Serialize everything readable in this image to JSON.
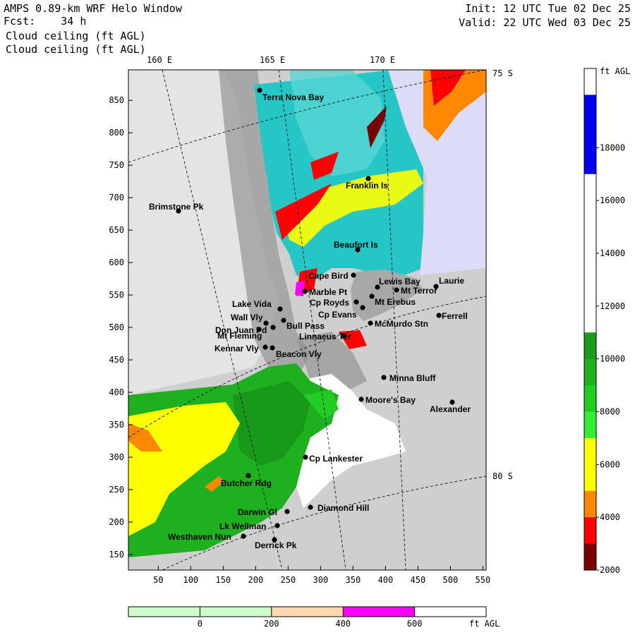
{
  "header": {
    "model": "AMPS 0.89-km WRF Helo Window",
    "fcst_label": "Fcst:",
    "fcst_value": "34 h",
    "field_1": "Cloud ceiling (ft AGL)",
    "field_2": "Cloud ceiling (ft AGL)",
    "init": "Init: 12 UTC Tue 02 Dec 25",
    "valid": "Valid: 22 UTC Wed 03 Dec 25"
  },
  "map": {
    "lon_labels": [
      "160 E",
      "165 E",
      "170 E"
    ],
    "lat_labels": [
      "75 S",
      "80 S"
    ],
    "x_ticks": [
      "50",
      "100",
      "150",
      "200",
      "250",
      "300",
      "350",
      "400",
      "450",
      "500",
      "550"
    ],
    "y_ticks": [
      "850",
      "800",
      "750",
      "700",
      "650",
      "600",
      "550",
      "500",
      "450",
      "400",
      "350",
      "300",
      "250",
      "200",
      "150"
    ],
    "places": [
      {
        "name": "Terra Nova Bay"
      },
      {
        "name": "Franklin Is"
      },
      {
        "name": "Brimstone Pk"
      },
      {
        "name": "Beaufort Is"
      },
      {
        "name": "Cape Bird"
      },
      {
        "name": "Lewis Bay"
      },
      {
        "name": "Laurie"
      },
      {
        "name": "Mt Terror"
      },
      {
        "name": "Marble Pt"
      },
      {
        "name": "Cp Royds"
      },
      {
        "name": "Mt Erebus"
      },
      {
        "name": "Lake Vida"
      },
      {
        "name": "Cp Evans"
      },
      {
        "name": "Ferrell"
      },
      {
        "name": "Wall Vly"
      },
      {
        "name": "Bull Pass"
      },
      {
        "name": "McMurdo Stn"
      },
      {
        "name": "Don Juan Pd"
      },
      {
        "name": "Mt Fleming"
      },
      {
        "name": "Linnaeus Ter"
      },
      {
        "name": "Kennar Vly"
      },
      {
        "name": "Beacon Vly"
      },
      {
        "name": "Minna Bluff"
      },
      {
        "name": "Moore's Bay"
      },
      {
        "name": "Alexander"
      },
      {
        "name": "Cp Lankester"
      },
      {
        "name": "Butcher Rdg"
      },
      {
        "name": "Darwin Gl"
      },
      {
        "name": "Diamond Hill"
      },
      {
        "name": "Lk Wellman"
      },
      {
        "name": "Westhaven Nun"
      },
      {
        "name": "Derrick Pk"
      }
    ]
  },
  "colorbar": {
    "unit": "ft AGL",
    "labels": [
      "18000",
      "16000",
      "14000",
      "12000",
      "10000",
      "8000",
      "6000",
      "4000",
      "2000"
    ],
    "colors": [
      "#ffffff",
      "#0000ee",
      "#0000ee",
      "#0000ee",
      "#ffffff",
      "#ffffff",
      "#ffffff",
      "#ffffff",
      "#ffffff",
      "#ffffff",
      "#1a9c1a",
      "#1fb01f",
      "#22cc22",
      "#33ee33",
      "#ffff00",
      "#ffff00",
      "#ff8800",
      "#ff0000",
      "#7a0000"
    ]
  },
  "bottom_bar": {
    "unit": "ft AGL",
    "labels": [
      "0",
      "200",
      "400",
      "600"
    ],
    "colors": [
      "#ccffcc",
      "#ccffcc",
      "#ffd8b0",
      "#ff00ff",
      "#ffffff"
    ]
  }
}
